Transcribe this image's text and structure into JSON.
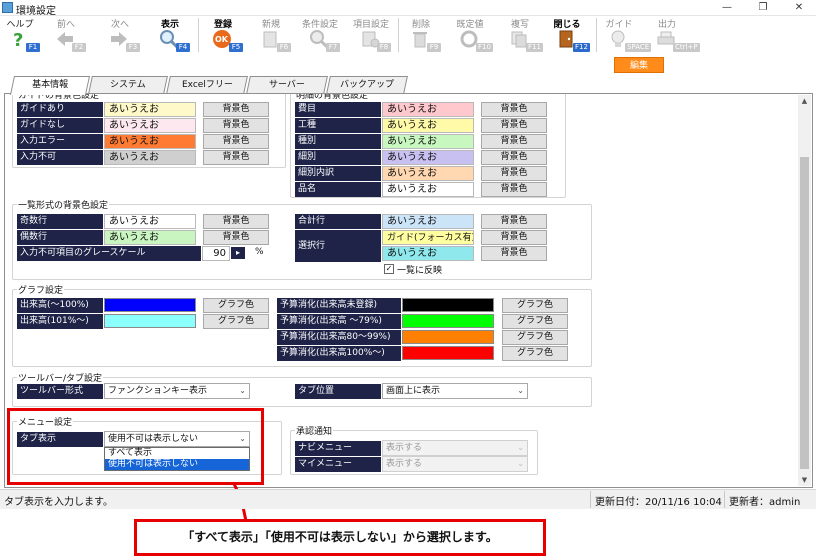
{
  "window": {
    "title": "環境設定",
    "minimize": "—",
    "restore": "❐",
    "close": "✕"
  },
  "toolbar": [
    {
      "label": "ヘルプ",
      "fkey": "F1",
      "icon": "help-icon",
      "enabled": true
    },
    {
      "label": "前へ",
      "fkey": "F2",
      "icon": "back-arrow-icon",
      "enabled": false
    },
    {
      "label": "次へ",
      "fkey": "F3",
      "icon": "forward-arrow-icon",
      "enabled": false
    },
    {
      "label": "表示",
      "fkey": "F4",
      "icon": "magnifier-icon",
      "enabled": true
    },
    {
      "label": "登録",
      "fkey": "F5",
      "icon": "ok-icon",
      "enabled": true
    },
    {
      "label": "新規",
      "fkey": "F6",
      "icon": "new-doc-icon",
      "enabled": false
    },
    {
      "label": "条件設定",
      "fkey": "F7",
      "icon": "condition-search-icon",
      "enabled": false
    },
    {
      "label": "項目設定",
      "fkey": "F8",
      "icon": "item-settings-icon",
      "enabled": false
    },
    {
      "label": "削除",
      "fkey": "F9",
      "icon": "trash-icon",
      "enabled": false
    },
    {
      "label": "既定値",
      "fkey": "F10",
      "icon": "reset-icon",
      "enabled": false
    },
    {
      "label": "複写",
      "fkey": "F11",
      "icon": "copy-icon",
      "enabled": false
    },
    {
      "label": "閉じる",
      "fkey": "F12",
      "icon": "close-door-icon",
      "enabled": true
    },
    {
      "label": "ガイド",
      "fkey": "SPACE",
      "icon": "guide-bulb-icon",
      "enabled": false
    },
    {
      "label": "出力",
      "fkey": "Ctrl+P",
      "icon": "printer-icon",
      "enabled": false
    }
  ],
  "edit_button": "編集",
  "tabs": [
    "基本情報",
    "システム",
    "Excelフリー",
    "サーバー",
    "バックアップ"
  ],
  "guide_bg": {
    "title": "ガイドの背景色設定",
    "rows": [
      {
        "label": "ガイドあり",
        "sample": "あいうえお",
        "color": "#fff8c8",
        "button": "背景色"
      },
      {
        "label": "ガイドなし",
        "sample": "あいうえお",
        "color": "#fde8f0",
        "button": "背景色"
      },
      {
        "label": "入力エラー",
        "sample": "あいうえお",
        "color": "#ff7b33",
        "button": "背景色"
      },
      {
        "label": "入力不可",
        "sample": "あいうえお",
        "color": "#cfcfcf",
        "button": "背景色"
      }
    ]
  },
  "detail_bg": {
    "title": "明細の背景色設定",
    "rows": [
      {
        "label": "費目",
        "sample": "あいうえお",
        "color": "#ffc8cc",
        "button": "背景色"
      },
      {
        "label": "工種",
        "sample": "あいうえお",
        "color": "#fffaa8",
        "button": "背景色"
      },
      {
        "label": "種別",
        "sample": "あいうえお",
        "color": "#c8f7c0",
        "button": "背景色"
      },
      {
        "label": "細別",
        "sample": "あいうえお",
        "color": "#c8c0f0",
        "button": "背景色"
      },
      {
        "label": "細別内訳",
        "sample": "あいうえお",
        "color": "#ffd7b0",
        "button": "背景色"
      },
      {
        "label": "品名",
        "sample": "あいうえお",
        "color": "#ffffff",
        "button": "背景色"
      }
    ]
  },
  "list_bg": {
    "title": "一覧形式の背景色設定",
    "rows": [
      {
        "label": "奇数行",
        "sample": "あいうえお",
        "color": "#ffffff",
        "button": "背景色"
      },
      {
        "label": "偶数行",
        "sample": "あいうえお",
        "color": "#c8f5c0",
        "button": "背景色"
      }
    ],
    "grayscale_label": "入力不可項目のグレースケール",
    "grayscale_value": "90",
    "grayscale_unit": "%",
    "total": {
      "label": "合計行",
      "sample": "あいうえお",
      "color": "#cce4f8",
      "button": "背景色"
    },
    "select_label": "選択行",
    "select_rows": [
      {
        "sample": "ガイド(フォーカス有)",
        "color": "#ffffa0",
        "button": "背景色"
      },
      {
        "sample": "あいうえお",
        "color": "#8ee8ec",
        "button": "背景色"
      }
    ],
    "checkbox_label": "一覧に反映",
    "checkbox_checked": true
  },
  "graph": {
    "title": "グラフ設定",
    "left_rows": [
      {
        "label": "出来高(～100%)",
        "color": "#0000ff",
        "button": "グラフ色"
      },
      {
        "label": "出来高(101%～)",
        "color": "#8cffff",
        "button": "グラフ色"
      }
    ],
    "right_rows": [
      {
        "label": "予算消化(出来高未登録)",
        "color": "#000000",
        "button": "グラフ色"
      },
      {
        "label": "予算消化(出来高 ～79%)",
        "color": "#00ff00",
        "button": "グラフ色"
      },
      {
        "label": "予算消化(出来高80～99%)",
        "color": "#ff8000",
        "button": "グラフ色"
      },
      {
        "label": "予算消化(出来高100%～)",
        "color": "#ff0000",
        "button": "グラフ色"
      }
    ]
  },
  "toolbar_tab": {
    "title": "ツールバー/タブ設定",
    "toolbar_label": "ツールバー形式",
    "toolbar_value": "ファンクションキー表示",
    "tabpos_label": "タブ位置",
    "tabpos_value": "画面上に表示"
  },
  "menu": {
    "title": "メニュー設定",
    "tab_label": "タブ表示",
    "tab_value": "使用不可は表示しない",
    "options": [
      "すべて表示",
      "使用不可は表示しない"
    ],
    "selected_index": 1
  },
  "approval": {
    "title": "承認通知",
    "navi_label": "ナビメニュー",
    "navi_value": "表示する",
    "my_label": "マイメニュー",
    "my_value": "表示する"
  },
  "status": {
    "message": "タブ表示を入力します。",
    "updated": "更新日付：20/11/16 10:04",
    "updater": "更新者：admin"
  },
  "caption": "「すべて表示」「使用不可は表示しない」から選択します。"
}
